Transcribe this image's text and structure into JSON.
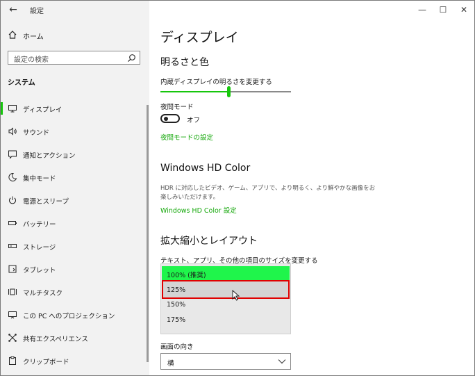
{
  "window": {
    "app_title": "設定",
    "minimize": "—",
    "maximize": "☐",
    "close": "✕"
  },
  "sidebar": {
    "home_label": "ホーム",
    "search_placeholder": "設定の検索",
    "section_title": "システム",
    "items": [
      {
        "label": "ディスプレイ",
        "icon": "monitor-icon",
        "active": true
      },
      {
        "label": "サウンド",
        "icon": "speaker-icon"
      },
      {
        "label": "通知とアクション",
        "icon": "notification-icon"
      },
      {
        "label": "集中モード",
        "icon": "moon-icon"
      },
      {
        "label": "電源とスリープ",
        "icon": "power-icon"
      },
      {
        "label": "バッテリー",
        "icon": "battery-icon"
      },
      {
        "label": "ストレージ",
        "icon": "storage-icon"
      },
      {
        "label": "タブレット",
        "icon": "tablet-icon"
      },
      {
        "label": "マルチタスク",
        "icon": "multitask-icon"
      },
      {
        "label": "この PC へのプロジェクション",
        "icon": "projection-icon"
      },
      {
        "label": "共有エクスペリエンス",
        "icon": "share-icon"
      },
      {
        "label": "クリップボード",
        "icon": "clipboard-icon"
      }
    ]
  },
  "main": {
    "page_title": "ディスプレイ",
    "brightness": {
      "heading": "明るさと色",
      "slider_label": "内蔵ディスプレイの明るさを変更する",
      "slider_value_fraction": 0.52,
      "night_mode_label": "夜間モード",
      "night_mode_state": "オフ",
      "night_mode_link": "夜間モードの設定"
    },
    "hdr": {
      "heading": "Windows HD Color",
      "description": "HDR に対応したビデオ、ゲーム、アプリで、より明るく、より鮮やかな画像をお楽しみいただけます。",
      "link": "Windows HD Color 設定"
    },
    "scale": {
      "heading": "拡大縮小とレイアウト",
      "label": "テキスト、アプリ、その他の項目のサイズを変更する",
      "options": [
        "100% (推奨)",
        "125%",
        "150%",
        "175%"
      ],
      "selected_index": 0,
      "hover_index": 1
    },
    "orientation": {
      "label": "画面の向き",
      "value": "横"
    }
  },
  "colors": {
    "accent": "#16c60c",
    "selected_option": "#1ff54b",
    "highlight_box": "#e00000"
  }
}
